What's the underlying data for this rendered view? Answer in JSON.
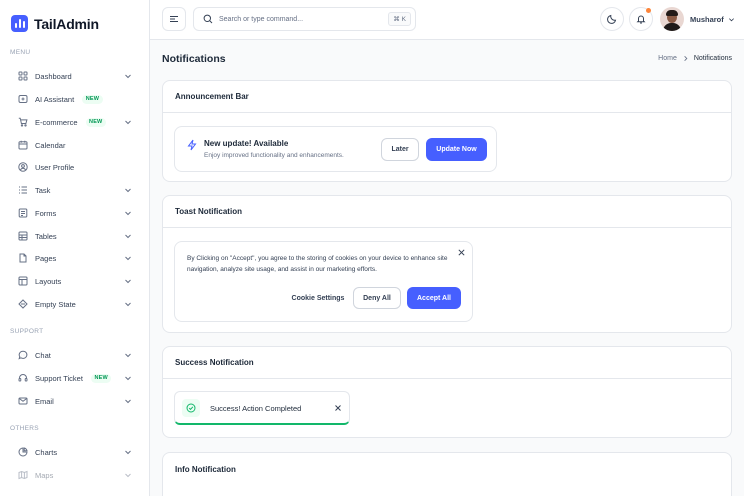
{
  "app": {
    "name": "TailAdmin",
    "brand_color": "#465fff"
  },
  "sidebar": {
    "sections": {
      "menu": "MENU",
      "support": "SUPPORT",
      "others": "OTHERS"
    },
    "items": [
      {
        "label": "Dashboard",
        "icon": "grid-icon",
        "chevron": true
      },
      {
        "label": "AI Assistant",
        "icon": "sparkle-icon",
        "badge": "NEW"
      },
      {
        "label": "E-commerce",
        "icon": "cart-icon",
        "badge": "NEW",
        "chevron": true
      },
      {
        "label": "Calendar",
        "icon": "calendar-icon"
      },
      {
        "label": "User Profile",
        "icon": "user-circle-icon"
      },
      {
        "label": "Task",
        "icon": "task-list-icon",
        "chevron": true
      },
      {
        "label": "Forms",
        "icon": "form-icon",
        "chevron": true
      },
      {
        "label": "Tables",
        "icon": "table-icon",
        "chevron": true
      },
      {
        "label": "Pages",
        "icon": "pages-icon",
        "chevron": true
      },
      {
        "label": "Layouts",
        "icon": "layouts-icon",
        "chevron": true
      },
      {
        "label": "Empty State",
        "icon": "empty-state-icon",
        "chevron": true
      },
      {
        "label": "Chat",
        "icon": "chat-icon",
        "chevron": true
      },
      {
        "label": "Support Ticket",
        "icon": "headset-icon",
        "badge": "NEW",
        "chevron": true
      },
      {
        "label": "Email",
        "icon": "mail-icon",
        "chevron": true
      },
      {
        "label": "Charts",
        "icon": "pie-chart-icon",
        "chevron": true
      },
      {
        "label": "Maps",
        "icon": "map-icon",
        "chevron": true
      }
    ]
  },
  "header": {
    "search_placeholder": "Search or type command...",
    "search_shortcut": "⌘ K",
    "user_name": "Musharof",
    "notification_dot_color": "#fd853a"
  },
  "page": {
    "title": "Notifications",
    "breadcrumb": {
      "home": "Home",
      "current": "Notifications"
    }
  },
  "announcement_bar": {
    "heading": "Announcement Bar",
    "title": "New update! Available",
    "subtitle": "Enjoy improved functionality and enhancements.",
    "later_label": "Later",
    "update_label": "Update Now"
  },
  "toast_notification": {
    "heading": "Toast Notification",
    "message": "By Clicking on \"Accept\", you agree to the storing of cookies on your device to enhance site navigation, analyze site usage, and assist in our marketing efforts.",
    "settings_label": "Cookie Settings",
    "deny_label": "Deny All",
    "accept_label": "Accept All"
  },
  "success_notification": {
    "heading": "Success Notification",
    "message": "Success! Action Completed",
    "accent_color": "#12b76a"
  },
  "info_notification": {
    "heading": "Info Notification"
  }
}
